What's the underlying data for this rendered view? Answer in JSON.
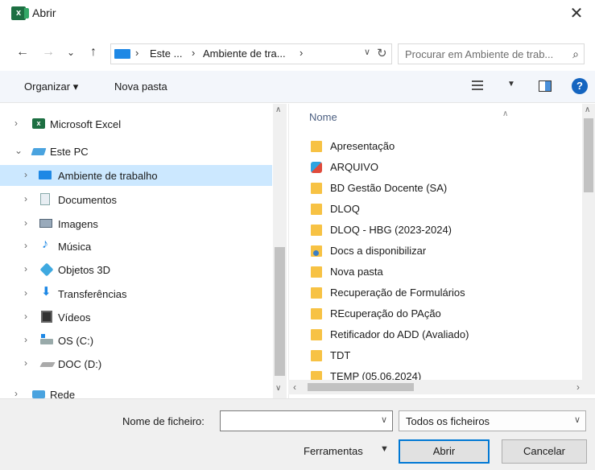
{
  "window": {
    "title": "Abrir",
    "close_symbol": "✕"
  },
  "nav": {
    "back_symbol": "←",
    "forward_symbol": "→",
    "recent_symbol": "⌄",
    "up_symbol": "↑",
    "address": {
      "crumbs": [
        "Este ...",
        "Ambiente de tra..."
      ],
      "separator": "›"
    },
    "search": {
      "placeholder": "Procurar em Ambiente de trab..."
    }
  },
  "toolbar": {
    "organize_label": "Organizar ▾",
    "new_folder_label": "Nova pasta",
    "help_symbol": "?"
  },
  "tree": [
    {
      "label": "Microsoft Excel",
      "icon": "excel-icon",
      "chevron": "›"
    },
    {
      "label": "Este PC",
      "icon": "pc-icon",
      "chevron": "⌄"
    },
    {
      "label": "Ambiente de trabalho",
      "icon": "desktop-icon",
      "chevron": "›",
      "selected": true
    },
    {
      "label": "Documentos",
      "icon": "documents-icon",
      "chevron": "›"
    },
    {
      "label": "Imagens",
      "icon": "images-icon",
      "chevron": "›"
    },
    {
      "label": "Música",
      "icon": "music-icon",
      "chevron": "›"
    },
    {
      "label": "Objetos 3D",
      "icon": "objects-3d-icon",
      "chevron": "›"
    },
    {
      "label": "Transferências",
      "icon": "download-icon",
      "chevron": "›"
    },
    {
      "label": "Vídeos",
      "icon": "video-icon",
      "chevron": "›"
    },
    {
      "label": "OS (C:)",
      "icon": "os-drive-icon",
      "chevron": "›"
    },
    {
      "label": "DOC (D:)",
      "icon": "drive-icon",
      "chevron": "›"
    },
    {
      "label": "Rede",
      "icon": "network-icon",
      "chevron": "›"
    }
  ],
  "files": {
    "column_name": "Nome",
    "items": [
      {
        "name": "Apresentação",
        "icon": "folder-icon"
      },
      {
        "name": "ARQUIVO",
        "icon": "app-icon"
      },
      {
        "name": "BD Gestão Docente (SA)",
        "icon": "folder-icon"
      },
      {
        "name": "DLOQ",
        "icon": "folder-icon"
      },
      {
        "name": "DLOQ - HBG (2023-2024)",
        "icon": "folder-icon"
      },
      {
        "name": "Docs a disponibilizar",
        "icon": "shared-folder-icon"
      },
      {
        "name": "Nova pasta",
        "icon": "folder-icon"
      },
      {
        "name": "Recuperação de Formulários",
        "icon": "folder-icon"
      },
      {
        "name": "REcuperação do PAção",
        "icon": "folder-icon"
      },
      {
        "name": "Retificador do ADD (Avaliado)",
        "icon": "folder-icon"
      },
      {
        "name": "TDT",
        "icon": "folder-icon"
      },
      {
        "name": "TEMP (05.06.2024)",
        "icon": "folder-icon"
      }
    ]
  },
  "footer": {
    "filename_label": "Nome de ficheiro:",
    "filename_value": "",
    "filetype_value": "Todos os ficheiros",
    "tools_label": "Ferramentas",
    "open_label": "Abrir",
    "cancel_label": "Cancelar"
  }
}
